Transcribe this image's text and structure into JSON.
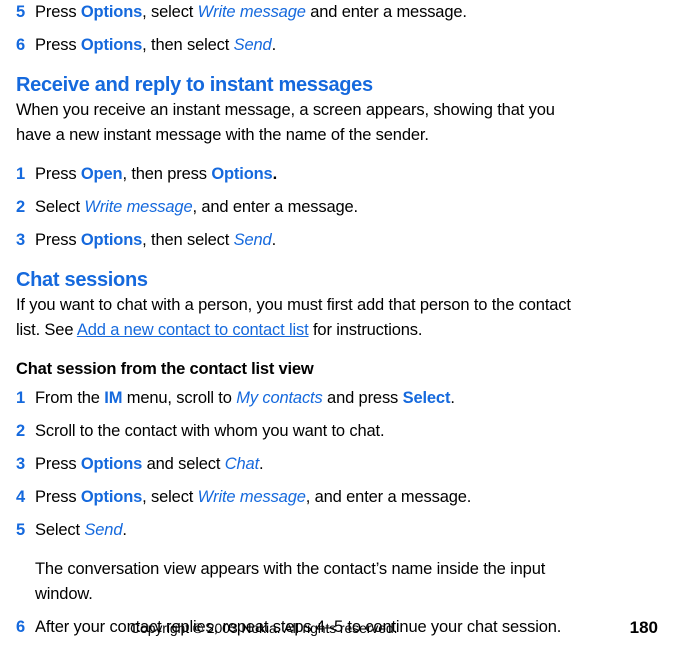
{
  "document": {
    "type": "user-guide-page",
    "colors": {
      "accent_blue": "#1569dd",
      "text_black": "#000000",
      "background": "#ffffff"
    }
  },
  "top_steps": [
    {
      "number": "5",
      "parts": [
        {
          "text": "Press ",
          "style": "plain"
        },
        {
          "text": "Options",
          "style": "keyword"
        },
        {
          "text": ", select ",
          "style": "plain"
        },
        {
          "text": "Write message",
          "style": "menu-item"
        },
        {
          "text": " and enter a message.",
          "style": "plain"
        }
      ]
    },
    {
      "number": "6",
      "parts": [
        {
          "text": "Press ",
          "style": "plain"
        },
        {
          "text": "Options",
          "style": "keyword"
        },
        {
          "text": ", then select ",
          "style": "plain"
        },
        {
          "text": "Send",
          "style": "menu-item"
        },
        {
          "text": ".",
          "style": "plain"
        }
      ]
    }
  ],
  "section_receive": {
    "heading": "Receive and reply to instant messages",
    "intro": "When you receive an instant message, a screen appears, showing that you have a new instant message with the name of the sender.",
    "steps": [
      {
        "number": "1",
        "parts": [
          {
            "text": "Press ",
            "style": "plain"
          },
          {
            "text": "Open",
            "style": "keyword"
          },
          {
            "text": ", then press ",
            "style": "plain"
          },
          {
            "text": "Options",
            "style": "keyword"
          },
          {
            "text": ".",
            "style": "bold-plain"
          }
        ]
      },
      {
        "number": "2",
        "parts": [
          {
            "text": "Select ",
            "style": "plain"
          },
          {
            "text": "Write message",
            "style": "menu-item"
          },
          {
            "text": ", and enter a message.",
            "style": "plain"
          }
        ]
      },
      {
        "number": "3",
        "parts": [
          {
            "text": "Press ",
            "style": "plain"
          },
          {
            "text": "Options",
            "style": "keyword"
          },
          {
            "text": ", then select ",
            "style": "plain"
          },
          {
            "text": "Send",
            "style": "menu-item"
          },
          {
            "text": ".",
            "style": "plain"
          }
        ]
      }
    ]
  },
  "section_chat": {
    "heading": "Chat sessions",
    "intro_parts": [
      {
        "text": "If you want to chat with a person, you must first add that person to the contact list. See ",
        "style": "plain"
      },
      {
        "text": "Add a new contact to contact list",
        "style": "link"
      },
      {
        "text": " for instructions.",
        "style": "plain"
      }
    ],
    "subheading": "Chat session from the contact list view",
    "steps": [
      {
        "number": "1",
        "parts": [
          {
            "text": "From the ",
            "style": "plain"
          },
          {
            "text": "IM",
            "style": "keyword"
          },
          {
            "text": " menu, scroll to ",
            "style": "plain"
          },
          {
            "text": "My contacts",
            "style": "menu-item"
          },
          {
            "text": " and press ",
            "style": "plain"
          },
          {
            "text": "Select",
            "style": "keyword"
          },
          {
            "text": ".",
            "style": "plain"
          }
        ]
      },
      {
        "number": "2",
        "parts": [
          {
            "text": "Scroll to the contact with whom you want to chat.",
            "style": "plain"
          }
        ]
      },
      {
        "number": "3",
        "parts": [
          {
            "text": "Press ",
            "style": "plain"
          },
          {
            "text": "Options",
            "style": "keyword"
          },
          {
            "text": " and select ",
            "style": "plain"
          },
          {
            "text": "Chat",
            "style": "menu-item"
          },
          {
            "text": ".",
            "style": "plain"
          }
        ]
      },
      {
        "number": "4",
        "parts": [
          {
            "text": "Press ",
            "style": "plain"
          },
          {
            "text": "Options",
            "style": "keyword"
          },
          {
            "text": ", select ",
            "style": "plain"
          },
          {
            "text": "Write message",
            "style": "menu-item"
          },
          {
            "text": ", and enter a message.",
            "style": "plain"
          }
        ]
      },
      {
        "number": "5",
        "parts": [
          {
            "text": "Select ",
            "style": "plain"
          },
          {
            "text": "Send",
            "style": "menu-item"
          },
          {
            "text": ".",
            "style": "plain"
          }
        ]
      }
    ],
    "note": "The conversation view appears with the contact’s name inside the input window.",
    "final_step": {
      "number": "6",
      "parts": [
        {
          "text": "After your contact replies, repeat steps 4–5 to continue your chat session.",
          "style": "plain"
        }
      ]
    }
  },
  "footer": {
    "copyright": "Copyright © 2003 Nokia. All rights reserved.",
    "page_number": "180"
  }
}
